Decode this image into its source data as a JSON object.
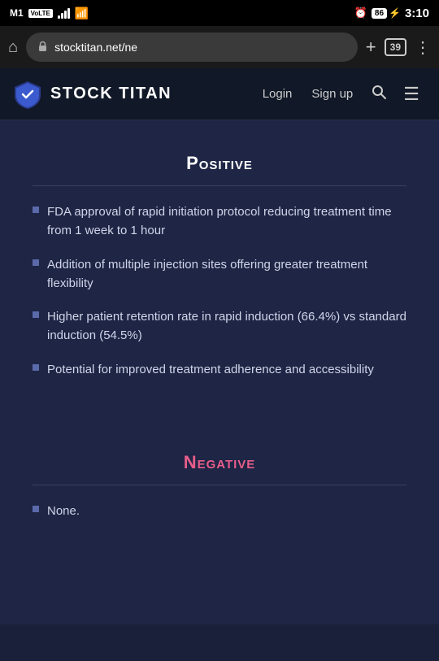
{
  "statusBar": {
    "carrier": "M1",
    "volte": "VoLTE",
    "time": "3:10",
    "battery": "86",
    "alarmIcon": "⏰"
  },
  "browser": {
    "addressText": "stocktitan.net/ne",
    "tabCount": "39",
    "addTabLabel": "+",
    "menuLabel": "⋮",
    "homeLabel": "⌂"
  },
  "siteHeader": {
    "title": "STOCK TITAN",
    "loginLabel": "Login",
    "signupLabel": "Sign up"
  },
  "positive": {
    "title": "Positive",
    "bullets": [
      "FDA approval of rapid initiation protocol reducing treatment time from 1 week to 1 hour",
      "Addition of multiple injection sites offering greater treatment flexibility",
      "Higher patient retention rate in rapid induction (66.4%) vs standard induction (54.5%)",
      "Potential for improved treatment adherence and accessibility"
    ]
  },
  "negative": {
    "title": "Negative",
    "bullets": [
      "None."
    ]
  }
}
